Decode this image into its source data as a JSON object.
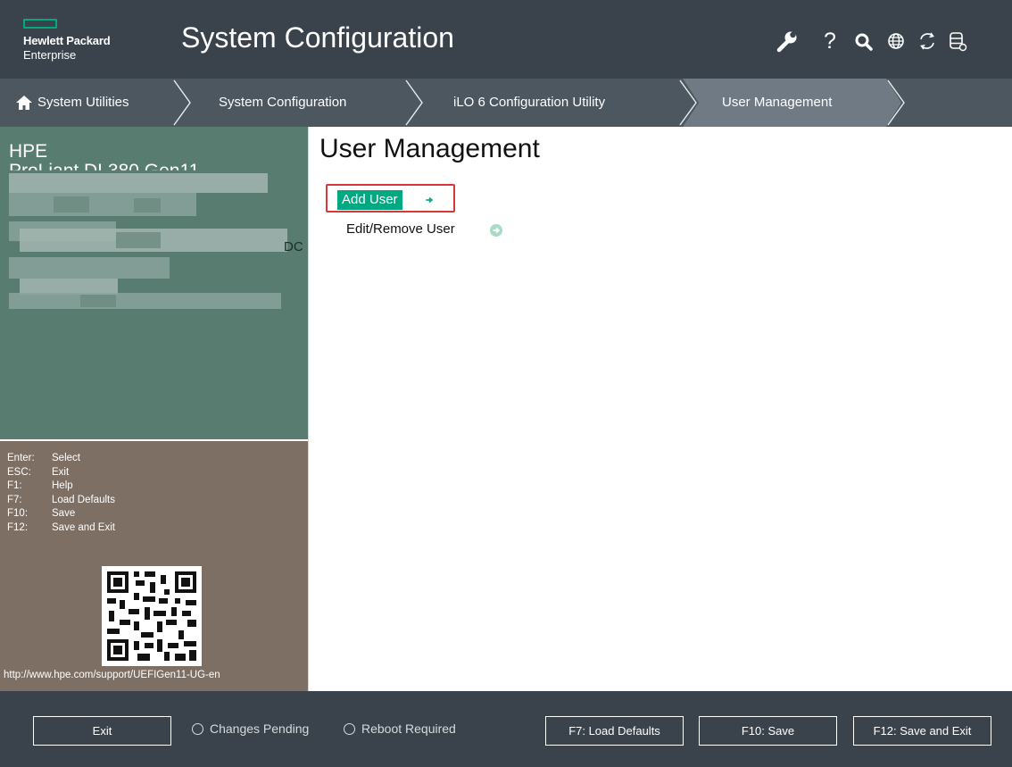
{
  "header": {
    "logo_line1": "Hewlett Packard",
    "logo_line2": "Enterprise",
    "title": "System Configuration",
    "icons": [
      "wrench-icon",
      "help-icon",
      "search-icon",
      "globe-icon",
      "refresh-icon",
      "database-icon"
    ],
    "help_glyph": "?"
  },
  "breadcrumb": {
    "items": [
      {
        "label": "System Utilities",
        "icon": "home-icon"
      },
      {
        "label": "System Configuration"
      },
      {
        "label": "iLO 6 Configuration Utility"
      },
      {
        "label": "User Management"
      }
    ]
  },
  "sidebar": {
    "brand": "HPE",
    "model_partial": "ProLiant DL380 Gen11",
    "partial_text": "DC",
    "keys": [
      {
        "key": "Enter:",
        "action": "Select"
      },
      {
        "key": "ESC:",
        "action": "Exit"
      },
      {
        "key": "F1:",
        "action": "Help"
      },
      {
        "key": "F7:",
        "action": "Load Defaults"
      },
      {
        "key": "F10:",
        "action": "Save"
      },
      {
        "key": "F12:",
        "action": "Save and Exit"
      }
    ],
    "help_url": "http://www.hpe.com/support/UEFIGen11-UG-en"
  },
  "main": {
    "title": "User Management",
    "items": [
      {
        "label": "Add User",
        "selected": true
      },
      {
        "label": "Edit/Remove User",
        "selected": false
      }
    ]
  },
  "footer": {
    "exit_label": "Exit",
    "changes_pending": "Changes Pending",
    "reboot_required": "Reboot Required",
    "load_defaults": "F7: Load Defaults",
    "save": "F10: Save",
    "save_exit": "F12: Save and Exit"
  },
  "colors": {
    "header_bg": "#3a434b",
    "breadcrumb_bg": "#4d575f",
    "accent_green": "#01a982",
    "sidebar_top_bg": "#587c70",
    "sidebar_bottom_bg": "#7e6f64",
    "focus_red": "#d9383a"
  }
}
